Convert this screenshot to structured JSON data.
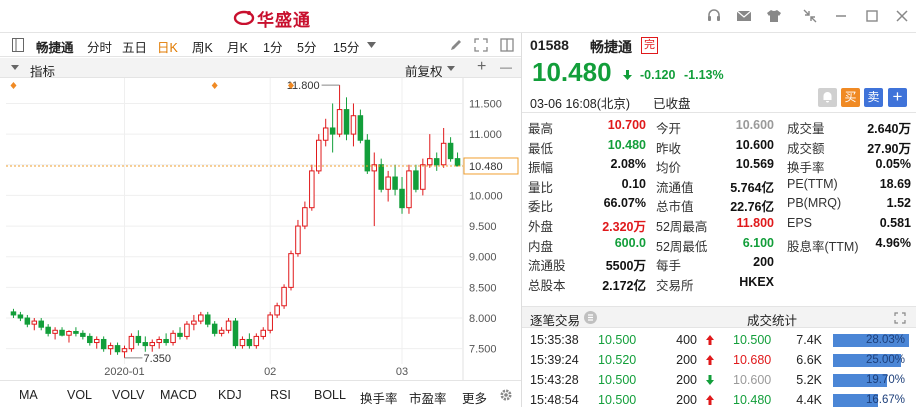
{
  "app": {
    "title": "华盛通",
    "brand_color": "#c8102e",
    "titlebar_icons": [
      "headset-icon",
      "mail-icon",
      "shirt-icon",
      "restore-icon",
      "collapse-icon",
      "minimize-icon",
      "maximize-icon",
      "close-icon"
    ]
  },
  "toolbar": {
    "stock_name": "畅捷通",
    "periods": [
      "分时",
      "五日",
      "日K",
      "周K",
      "月K",
      "1分",
      "5分",
      "15分"
    ],
    "active_period": "日K"
  },
  "indicator_bar": {
    "label": "指标",
    "adjust": "前复权",
    "plus": "+",
    "minus": "—"
  },
  "chart_data": {
    "type": "candlestick",
    "ylim": [
      7.25,
      11.85
    ],
    "y_ticks": [
      "11.500",
      "11.000",
      "10.500",
      "10.000",
      "9.500",
      "9.000",
      "8.500",
      "8.000",
      "7.500"
    ],
    "y_tick_values": [
      11.5,
      11.0,
      10.5,
      10.0,
      9.5,
      9.0,
      8.5,
      8.0,
      7.5
    ],
    "x_labels": [
      {
        "label": "2020-01",
        "index": 16
      },
      {
        "label": "02",
        "index": 37
      },
      {
        "label": "03",
        "index": 56
      }
    ],
    "current_price_label": "10.480",
    "current_price": 10.48,
    "high_label": "11.800",
    "high_index": 47,
    "low_label": "7.350",
    "low_index": 16,
    "up_color": "#e0191b",
    "down_color": "#129e3a",
    "grid": true,
    "candles": [
      [
        8.1,
        8.15,
        8.0,
        8.05
      ],
      [
        8.05,
        8.1,
        7.95,
        8.0
      ],
      [
        8.0,
        8.05,
        7.85,
        7.9
      ],
      [
        7.9,
        8.0,
        7.8,
        7.95
      ],
      [
        7.95,
        8.0,
        7.8,
        7.85
      ],
      [
        7.85,
        7.9,
        7.7,
        7.75
      ],
      [
        7.75,
        7.85,
        7.65,
        7.8
      ],
      [
        7.8,
        7.85,
        7.7,
        7.72
      ],
      [
        7.72,
        7.8,
        7.6,
        7.78
      ],
      [
        7.78,
        7.85,
        7.7,
        7.75
      ],
      [
        7.75,
        7.8,
        7.65,
        7.7
      ],
      [
        7.7,
        7.75,
        7.55,
        7.6
      ],
      [
        7.6,
        7.7,
        7.5,
        7.65
      ],
      [
        7.65,
        7.7,
        7.45,
        7.5
      ],
      [
        7.5,
        7.6,
        7.4,
        7.55
      ],
      [
        7.55,
        7.6,
        7.4,
        7.45
      ],
      [
        7.45,
        7.55,
        7.35,
        7.5
      ],
      [
        7.5,
        7.75,
        7.45,
        7.7
      ],
      [
        7.7,
        7.8,
        7.55,
        7.6
      ],
      [
        7.6,
        7.7,
        7.45,
        7.55
      ],
      [
        7.55,
        7.65,
        7.45,
        7.6
      ],
      [
        7.6,
        7.7,
        7.5,
        7.65
      ],
      [
        7.65,
        7.75,
        7.55,
        7.6
      ],
      [
        7.6,
        7.8,
        7.55,
        7.75
      ],
      [
        7.75,
        7.85,
        7.65,
        7.7
      ],
      [
        7.7,
        7.95,
        7.65,
        7.9
      ],
      [
        7.9,
        8.05,
        7.8,
        7.95
      ],
      [
        7.95,
        8.1,
        7.9,
        8.05
      ],
      [
        8.05,
        8.1,
        7.85,
        7.9
      ],
      [
        7.9,
        7.95,
        7.7,
        7.75
      ],
      [
        7.75,
        7.85,
        7.7,
        7.8
      ],
      [
        7.8,
        8.0,
        7.75,
        7.95
      ],
      [
        7.95,
        8.0,
        7.5,
        7.55
      ],
      [
        7.55,
        7.7,
        7.5,
        7.65
      ],
      [
        7.65,
        7.75,
        7.5,
        7.55
      ],
      [
        7.55,
        7.75,
        7.5,
        7.7
      ],
      [
        7.7,
        7.85,
        7.65,
        7.8
      ],
      [
        7.8,
        8.1,
        7.75,
        8.05
      ],
      [
        8.05,
        8.25,
        8.0,
        8.2
      ],
      [
        8.2,
        8.55,
        8.15,
        8.5
      ],
      [
        8.5,
        9.1,
        8.45,
        9.05
      ],
      [
        9.05,
        9.6,
        9.0,
        9.5
      ],
      [
        9.5,
        9.9,
        9.45,
        9.8
      ],
      [
        9.8,
        10.5,
        9.75,
        10.4
      ],
      [
        10.4,
        11.0,
        10.35,
        10.9
      ],
      [
        10.9,
        11.25,
        10.8,
        11.1
      ],
      [
        11.1,
        11.5,
        10.7,
        11.0
      ],
      [
        11.0,
        11.8,
        10.95,
        11.4
      ],
      [
        11.4,
        11.6,
        10.9,
        11.0
      ],
      [
        11.0,
        11.5,
        10.8,
        11.3
      ],
      [
        11.3,
        11.4,
        10.85,
        10.9
      ],
      [
        10.9,
        11.0,
        10.35,
        10.4
      ],
      [
        10.4,
        10.7,
        9.5,
        10.5
      ],
      [
        10.5,
        10.6,
        10.05,
        10.1
      ],
      [
        10.1,
        10.4,
        9.9,
        10.3
      ],
      [
        10.3,
        10.5,
        10.0,
        10.1
      ],
      [
        10.1,
        10.3,
        9.7,
        9.8
      ],
      [
        9.8,
        10.5,
        9.7,
        10.4
      ],
      [
        10.4,
        10.5,
        10.05,
        10.1
      ],
      [
        10.1,
        10.6,
        10.0,
        10.5
      ],
      [
        10.5,
        11.0,
        10.45,
        10.6
      ],
      [
        10.6,
        10.7,
        10.4,
        10.5
      ],
      [
        10.5,
        11.1,
        10.45,
        10.85
      ],
      [
        10.85,
        10.95,
        10.55,
        10.6
      ],
      [
        10.6,
        10.7,
        10.48,
        10.48
      ]
    ]
  },
  "bottom_tabs": [
    "MA",
    "VOL",
    "VOLV",
    "MACD",
    "KDJ",
    "RSI",
    "BOLL",
    "换手率",
    "市盈率",
    "更多"
  ],
  "quote": {
    "code": "01588",
    "name": "畅捷通",
    "badge": "完",
    "price": "10.480",
    "change": "-0.120",
    "change_pct": "-1.13%",
    "time": "03-06 16:08(北京)",
    "status": "已收盘",
    "buy": "买",
    "sell": "卖",
    "add": "+"
  },
  "fields": [
    [
      {
        "label": "最高",
        "value": "10.700",
        "color": "red"
      },
      {
        "label": "今开",
        "value": "10.600",
        "color": "gray"
      },
      {
        "label": "成交量",
        "value": "2.640万",
        "color": "black"
      }
    ],
    [
      {
        "label": "最低",
        "value": "10.480",
        "color": "green"
      },
      {
        "label": "昨收",
        "value": "10.600",
        "color": "black"
      },
      {
        "label": "成交额",
        "value": "27.90万",
        "color": "black"
      }
    ],
    [
      {
        "label": "振幅",
        "value": "2.08%",
        "color": "black"
      },
      {
        "label": "均价",
        "value": "10.569",
        "color": "black"
      },
      {
        "label": "换手率",
        "value": "0.05%",
        "color": "black"
      }
    ],
    [
      {
        "label": "量比",
        "value": "0.10",
        "color": "black"
      },
      {
        "label": "流通值",
        "value": "5.764亿",
        "color": "black"
      },
      {
        "label": "PE(TTM)",
        "value": "18.69",
        "color": "black"
      }
    ],
    [
      {
        "label": "委比",
        "value": "66.07%",
        "color": "black"
      },
      {
        "label": "总市值",
        "value": "22.76亿",
        "color": "black"
      },
      {
        "label": "PB(MRQ)",
        "value": "1.52",
        "color": "black"
      }
    ],
    [
      {
        "label": "外盘",
        "value": "2.320万",
        "color": "red"
      },
      {
        "label": "52周最高",
        "value": "11.800",
        "color": "red"
      },
      {
        "label": "EPS",
        "value": "0.581",
        "color": "black"
      }
    ],
    [
      {
        "label": "内盘",
        "value": "600.0",
        "color": "green"
      },
      {
        "label": "52周最低",
        "value": "6.100",
        "color": "green"
      },
      {
        "label": "股息率(TTM)",
        "value": "4.96%",
        "color": "black"
      }
    ],
    [
      {
        "label": "流通股",
        "value": "5500万",
        "color": "black"
      },
      {
        "label": "每手",
        "value": "200",
        "color": "black"
      },
      {
        "label": "",
        "value": "",
        "color": "black"
      }
    ],
    [
      {
        "label": "总股本",
        "value": "2.172亿",
        "color": "black"
      },
      {
        "label": "交易所",
        "value": "HKEX",
        "color": "black"
      },
      {
        "label": "",
        "value": "",
        "color": "black"
      }
    ]
  ],
  "trades_header": {
    "left": "逐笔交易",
    "right": "成交统计"
  },
  "trades": [
    {
      "time": "15:35:38",
      "price": "10.500",
      "price_color": "green",
      "vol": "400",
      "dir": "up"
    },
    {
      "time": "15:39:24",
      "price": "10.520",
      "price_color": "green",
      "vol": "200",
      "dir": "up"
    },
    {
      "time": "15:43:28",
      "price": "10.500",
      "price_color": "green",
      "vol": "200",
      "dir": "down"
    },
    {
      "time": "15:48:54",
      "price": "10.500",
      "price_color": "green",
      "vol": "200",
      "dir": "up"
    }
  ],
  "stats": [
    {
      "price": "10.500",
      "price_color": "green",
      "vol": "7.4K",
      "pct": "28.03%",
      "fraction": 0.2803
    },
    {
      "price": "10.680",
      "price_color": "red",
      "vol": "6.6K",
      "pct": "25.00%",
      "fraction": 0.25
    },
    {
      "price": "10.600",
      "price_color": "gray",
      "vol": "5.2K",
      "pct": "19.70%",
      "fraction": 0.197
    },
    {
      "price": "10.480",
      "price_color": "green",
      "vol": "4.4K",
      "pct": "16.67%",
      "fraction": 0.1667
    }
  ]
}
